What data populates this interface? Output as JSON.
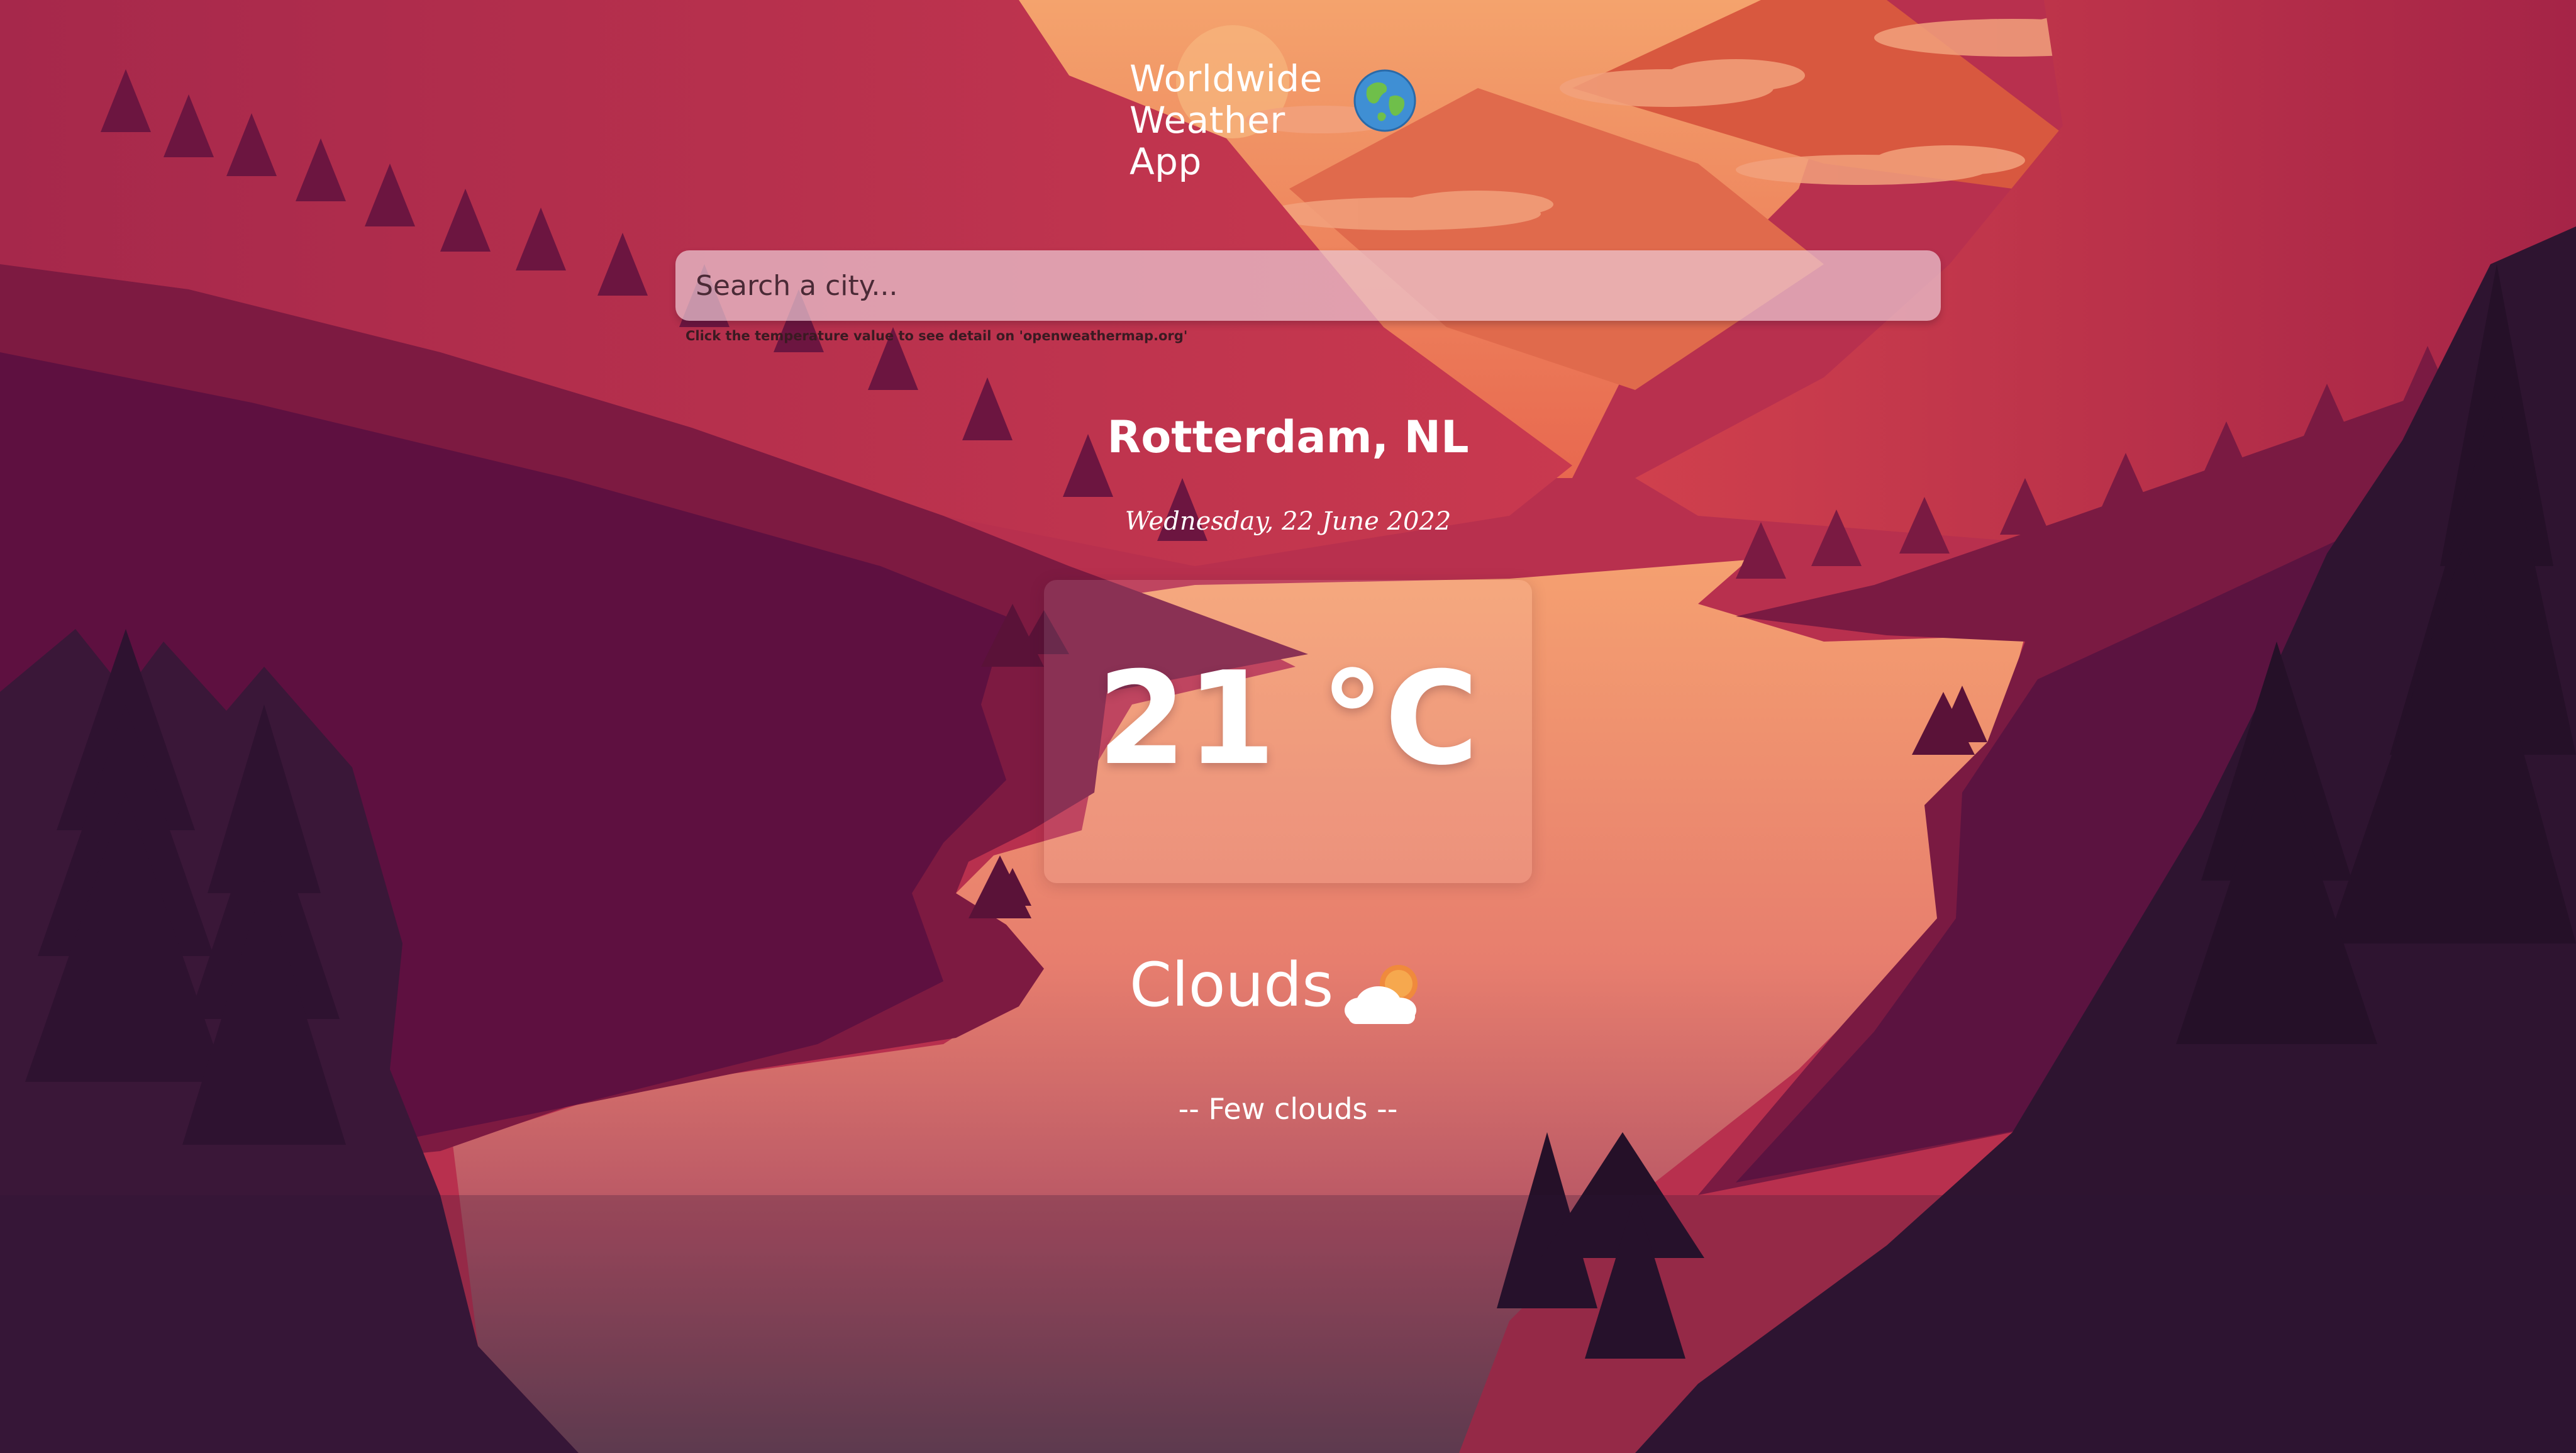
{
  "app": {
    "title": "Worldwide Weather App",
    "title_icon": "globe-icon"
  },
  "search": {
    "placeholder": "Search a city...",
    "value": ""
  },
  "hint": {
    "text": "Click the temperature value to see detail on 'openweathermap.org'"
  },
  "location": {
    "city": "Rotterdam, NL",
    "date": "Wednesday, 22 June 2022"
  },
  "weather": {
    "temperature": "21 °C",
    "main": "Clouds",
    "main_icon": "cloud-sun-icon",
    "description": "-- Few clouds --"
  },
  "colors": {
    "text": "#ffffff",
    "search_bg": "#ecc8d2",
    "hint_text": "#3a1a22",
    "sky_orange": "#f0845c",
    "valley_pink": "#c83a56",
    "forest_dark": "#531238"
  }
}
